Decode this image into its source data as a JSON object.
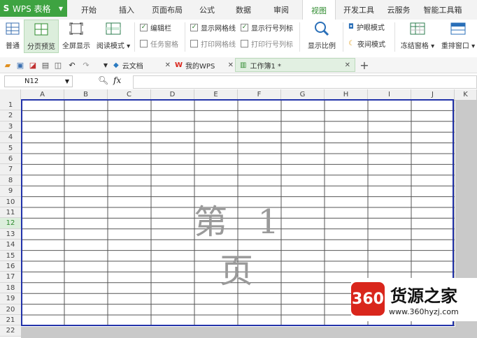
{
  "app": {
    "title": "WPS 表格"
  },
  "tabs": [
    "开始",
    "插入",
    "页面布局",
    "公式",
    "数据",
    "审阅",
    "视图",
    "开发工具",
    "云服务",
    "智能工具箱"
  ],
  "active_tab": "视图",
  "ribbon": {
    "normal": "普通",
    "page_break_preview": "分页预览",
    "fullscreen": "全屏显示",
    "reading_mode": "阅读模式",
    "edit_bar": "编辑栏",
    "task_pane": "任务窗格",
    "show_gridlines": "显示网格线",
    "print_gridlines": "打印网格线",
    "show_headers": "显示行号列标",
    "print_headers": "打印行号列标",
    "zoom": "显示比例",
    "eye_mode": "护眼模式",
    "night_mode": "夜间模式",
    "freeze_panes": "冻结窗格",
    "rearrange_windows": "重排窗口"
  },
  "doc_tabs": [
    {
      "label": "云文档"
    },
    {
      "label": "我的WPS"
    },
    {
      "label": "工作簿1 *"
    }
  ],
  "formula_bar": {
    "cell_ref": "N12",
    "fx": "fx",
    "formula": ""
  },
  "columns": [
    "A",
    "B",
    "C",
    "D",
    "E",
    "F",
    "G",
    "H",
    "I",
    "J",
    "K"
  ],
  "rows": [
    "1",
    "2",
    "3",
    "4",
    "5",
    "6",
    "7",
    "8",
    "9",
    "10",
    "11",
    "12",
    "13",
    "14",
    "15",
    "16",
    "17",
    "18",
    "19",
    "20",
    "21",
    "22"
  ],
  "active_row": "12",
  "page_watermark": "第 1 页",
  "logo": {
    "badge": "360",
    "title": "货源之家",
    "url": "www.360hyzj.com"
  },
  "colors": {
    "accent": "#3ea341",
    "page_border": "#2233aa",
    "logo_red": "#d9261c"
  }
}
